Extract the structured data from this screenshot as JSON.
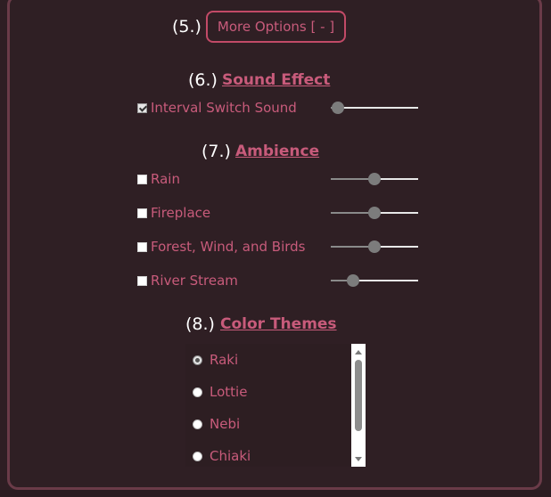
{
  "section5": {
    "num": "(5.)",
    "more_options_label": "More Options  [ - ]"
  },
  "section6": {
    "num": "(6.)",
    "title": "Sound Effect",
    "items": [
      {
        "label": "Interval Switch Sound",
        "checked": true,
        "volume": 0.08
      }
    ]
  },
  "section7": {
    "num": "(7.)",
    "title": "Ambience",
    "items": [
      {
        "label": "Rain",
        "checked": false,
        "volume": 0.5
      },
      {
        "label": "Fireplace",
        "checked": false,
        "volume": 0.5
      },
      {
        "label": "Forest, Wind, and Birds",
        "checked": false,
        "volume": 0.5
      },
      {
        "label": "River Stream",
        "checked": false,
        "volume": 0.25
      }
    ]
  },
  "section8": {
    "num": "(8.)",
    "title": "Color Themes",
    "themes": [
      {
        "label": "Raki",
        "selected": true
      },
      {
        "label": "Lottie",
        "selected": false
      },
      {
        "label": "Nebi",
        "selected": false
      },
      {
        "label": "Chiaki",
        "selected": false
      }
    ]
  },
  "colors": {
    "accent": "#c85b7b",
    "background": "#2e1e23",
    "border": "#6a3b48"
  }
}
